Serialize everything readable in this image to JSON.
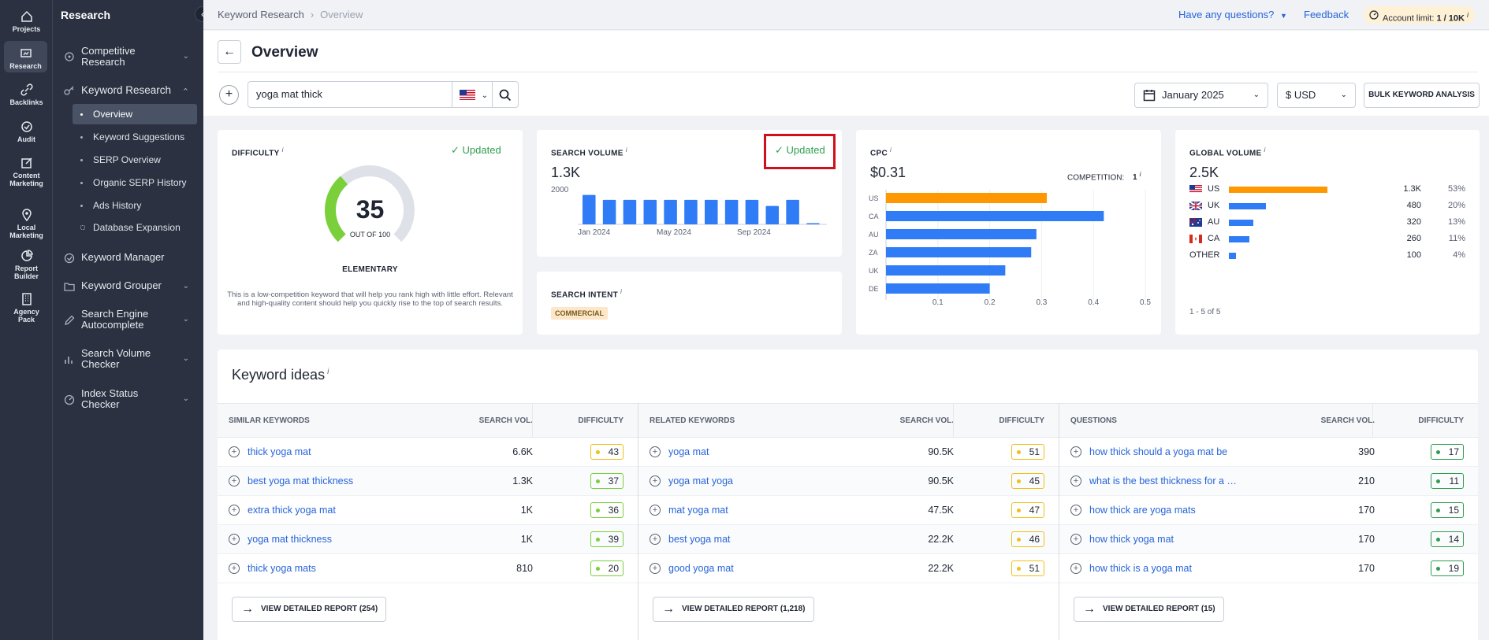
{
  "rail": [
    {
      "label": "Projects",
      "icon": "home-icon"
    },
    {
      "label": "Research",
      "icon": "research-icon"
    },
    {
      "label": "Backlinks",
      "icon": "link-icon"
    },
    {
      "label": "Audit",
      "icon": "audit-icon"
    },
    {
      "label": "Content\nMarketing",
      "icon": "edit-icon"
    },
    {
      "label": "Local\nMarketing",
      "icon": "pin-icon"
    },
    {
      "label": "Report\nBuilder",
      "icon": "pie-icon"
    },
    {
      "label": "Agency\nPack",
      "icon": "building-icon"
    }
  ],
  "sidebar": {
    "title": "Research",
    "competitive": "Competitive\nResearch",
    "keyword_research": "Keyword Research",
    "subitems": [
      "Overview",
      "Keyword Suggestions",
      "SERP Overview",
      "Organic SERP History",
      "Ads History",
      "Database Expansion"
    ],
    "keyword_manager": "Keyword Manager",
    "keyword_grouper": "Keyword Grouper",
    "autocomplete": "Search Engine\nAutocomplete",
    "volume_checker": "Search Volume\nChecker",
    "index_checker": "Index Status\nChecker"
  },
  "topbar": {
    "crumb1": "Keyword Research",
    "crumb2": "Overview",
    "help": "Have any questions?",
    "feedback": "Feedback",
    "account": "Account limit: ",
    "account_val": "1 / 10K",
    "info": "i"
  },
  "header": {
    "title": "Overview",
    "query": "yoga mat thick",
    "date": "January 2025",
    "currency": "$ USD",
    "bulk": "BULK KEYWORD ANALYSIS"
  },
  "difficulty": {
    "title": "DIFFICULTY",
    "updated": "Updated",
    "value": "35",
    "fraction": 0.35,
    "out_of": "OUT OF 100",
    "level": "ELEMENTARY",
    "desc": "This is a low-competition keyword that will help you rank high with little effort. Relevant and high-quality content should help you quickly rise to the top of search results."
  },
  "search_volume": {
    "title": "SEARCH VOLUME",
    "updated": "Updated",
    "value": "1.3K",
    "ytick": "2000",
    "xlabels": [
      "Jan 2024",
      "May 2024",
      "Sep 2024"
    ]
  },
  "search_intent": {
    "title": "SEARCH INTENT",
    "badge": "COMMERCIAL"
  },
  "cpc": {
    "title": "CPC",
    "value": "$0.31",
    "competition_label": "COMPETITION:",
    "competition": "1",
    "xticks": [
      "0.1",
      "0.2",
      "0.3",
      "0.4",
      "0.5"
    ]
  },
  "global_volume": {
    "title": "GLOBAL VOLUME",
    "value": "2.5K",
    "footer": "1 - 5 of 5",
    "rows": [
      {
        "country": "US",
        "vol": "1.3K",
        "pct": "53%",
        "frac": 0.53
      },
      {
        "country": "UK",
        "vol": "480",
        "pct": "20%",
        "frac": 0.2
      },
      {
        "country": "AU",
        "vol": "320",
        "pct": "13%",
        "frac": 0.13
      },
      {
        "country": "CA",
        "vol": "260",
        "pct": "11%",
        "frac": 0.11
      },
      {
        "country": "OTHER",
        "vol": "100",
        "pct": "4%",
        "frac": 0.04
      }
    ]
  },
  "chart_data": [
    {
      "type": "bar",
      "title": "SEARCH VOLUME",
      "categories": [
        "Jan 2024",
        "Feb 2024",
        "Mar 2024",
        "Apr 2024",
        "May 2024",
        "Jun 2024",
        "Jul 2024",
        "Aug 2024",
        "Sep 2024",
        "Oct 2024",
        "Nov 2024",
        "Dec 2024"
      ],
      "values": [
        2400,
        2000,
        2000,
        2000,
        2000,
        2000,
        2000,
        2000,
        2000,
        1500,
        2000,
        100
      ],
      "ylim": [
        0,
        2700
      ],
      "color": "#2f7cf6"
    },
    {
      "type": "bar",
      "title": "CPC",
      "categories": [
        "US",
        "CA",
        "AU",
        "ZA",
        "UK",
        "DE"
      ],
      "values": [
        0.31,
        0.42,
        0.29,
        0.28,
        0.23,
        0.2
      ],
      "xlim": [
        0,
        0.5
      ],
      "colors": [
        "#ff9800",
        "#2f7cf6",
        "#2f7cf6",
        "#2f7cf6",
        "#2f7cf6",
        "#2f7cf6"
      ]
    }
  ],
  "ideas": {
    "title": "Keyword ideas",
    "vol_head": "SEARCH VOL.",
    "kd_head": "DIFFICULTY",
    "cols": [
      {
        "head": "SIMILAR KEYWORDS",
        "button": "VIEW DETAILED REPORT (254)",
        "rows": [
          {
            "kw": "thick yoga mat",
            "vol": "6.6K",
            "kd": "43",
            "c": "y"
          },
          {
            "kw": "best yoga mat thickness",
            "vol": "1.3K",
            "kd": "37",
            "c": "g"
          },
          {
            "kw": "extra thick yoga mat",
            "vol": "1K",
            "kd": "36",
            "c": "g"
          },
          {
            "kw": "yoga mat thickness",
            "vol": "1K",
            "kd": "39",
            "c": "g"
          },
          {
            "kw": "thick yoga mats",
            "vol": "810",
            "kd": "20",
            "c": "g"
          }
        ]
      },
      {
        "head": "RELATED KEYWORDS",
        "button": "VIEW DETAILED REPORT (1,218)",
        "rows": [
          {
            "kw": "yoga mat",
            "vol": "90.5K",
            "kd": "51",
            "c": "y"
          },
          {
            "kw": "yoga mat yoga",
            "vol": "90.5K",
            "kd": "45",
            "c": "y"
          },
          {
            "kw": "mat yoga mat",
            "vol": "47.5K",
            "kd": "47",
            "c": "y"
          },
          {
            "kw": "best yoga mat",
            "vol": "22.2K",
            "kd": "46",
            "c": "y"
          },
          {
            "kw": "good yoga mat",
            "vol": "22.2K",
            "kd": "51",
            "c": "y"
          }
        ]
      },
      {
        "head": "QUESTIONS",
        "button": "VIEW DETAILED REPORT (15)",
        "rows": [
          {
            "kw": "how thick should a yoga mat be",
            "vol": "390",
            "kd": "17",
            "c": "dg"
          },
          {
            "kw": "what is the best thickness for a yog...",
            "vol": "210",
            "kd": "11",
            "c": "dg"
          },
          {
            "kw": "how thick are yoga mats",
            "vol": "170",
            "kd": "15",
            "c": "dg"
          },
          {
            "kw": "how thick yoga mat",
            "vol": "170",
            "kd": "14",
            "c": "dg"
          },
          {
            "kw": "how thick is a yoga mat",
            "vol": "170",
            "kd": "19",
            "c": "dg"
          }
        ]
      }
    ]
  }
}
